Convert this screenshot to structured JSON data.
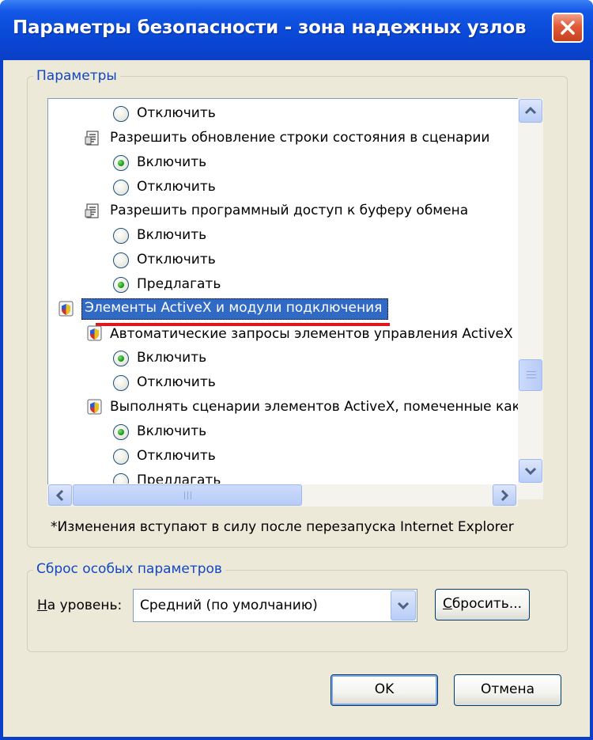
{
  "window": {
    "title": "Параметры безопасности - зона надежных узлов"
  },
  "settings_group": {
    "legend": "Параметры",
    "items": [
      {
        "kind": "radio",
        "label": "Отключить",
        "checked": false
      },
      {
        "kind": "script-setting",
        "label": "Разрешить обновление строки состояния в сценарии"
      },
      {
        "kind": "radio",
        "label": "Включить",
        "checked": true
      },
      {
        "kind": "radio",
        "label": "Отключить",
        "checked": false
      },
      {
        "kind": "script-setting",
        "label": "Разрешить программный доступ к буферу обмена"
      },
      {
        "kind": "radio",
        "label": "Включить",
        "checked": false
      },
      {
        "kind": "radio",
        "label": "Отключить",
        "checked": false
      },
      {
        "kind": "radio",
        "label": "Предлагать",
        "checked": true
      },
      {
        "kind": "category",
        "label": "Элементы ActiveX и модули подключения",
        "selected": true
      },
      {
        "kind": "activex-setting",
        "label": "Автоматические запросы элементов управления ActiveX"
      },
      {
        "kind": "radio",
        "label": "Включить",
        "checked": true
      },
      {
        "kind": "radio",
        "label": "Отключить",
        "checked": false
      },
      {
        "kind": "activex-setting",
        "label": "Выполнять сценарии элементов ActiveX, помеченные как"
      },
      {
        "kind": "radio",
        "label": "Включить",
        "checked": true
      },
      {
        "kind": "radio",
        "label": "Отключить",
        "checked": false
      },
      {
        "kind": "radio",
        "label": "Предлагать",
        "checked": false
      }
    ],
    "note": "*Изменения вступают в силу после перезапуска Internet Explorer"
  },
  "reset_group": {
    "legend": "Сброс особых параметров",
    "level_label_underlined": "Н",
    "level_label_rest": "а уровень:",
    "level_value": "Средний (по умолчанию)",
    "reset_button_underlined": "С",
    "reset_button_rest": "бросить..."
  },
  "buttons": {
    "ok": "OK",
    "cancel": "Отмена"
  },
  "colors": {
    "titlebar": "#0a49d8",
    "selection": "#316ac5",
    "annotation_underline": "#e0161c",
    "radio_checked": "#21a121"
  }
}
